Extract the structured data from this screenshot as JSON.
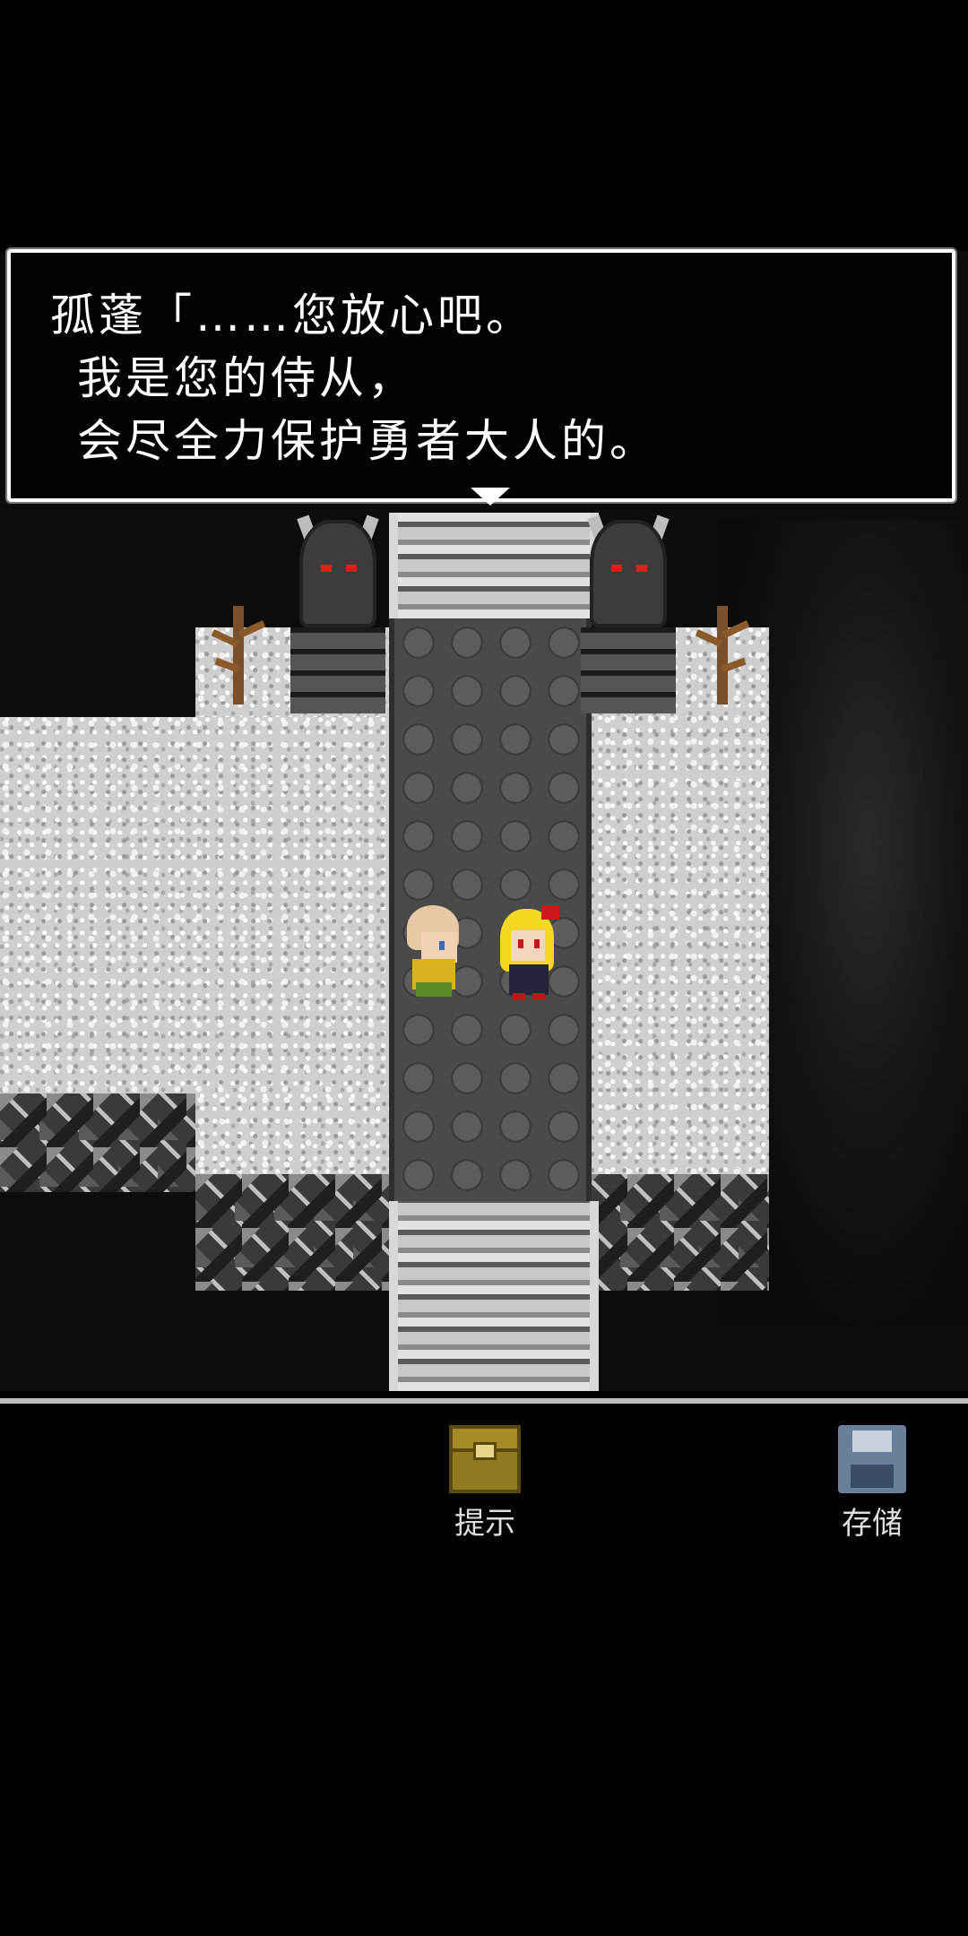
{
  "dialog": {
    "line1": "孤蓬「……您放心吧。",
    "line2": "我是您的侍从，",
    "line3": "会尽全力保护勇者大人的。"
  },
  "menu": {
    "hint_label": "提示",
    "save_label": "存储"
  },
  "icons": {
    "hint": "treasure-chest-icon",
    "save": "floppy-disk-icon",
    "continue": "triangle-down-icon"
  },
  "colors": {
    "dialog_background": "#000000",
    "dialog_border": "#ffffff",
    "hint_icon": "#8f7a22",
    "save_icon": "#6a7f9a"
  }
}
